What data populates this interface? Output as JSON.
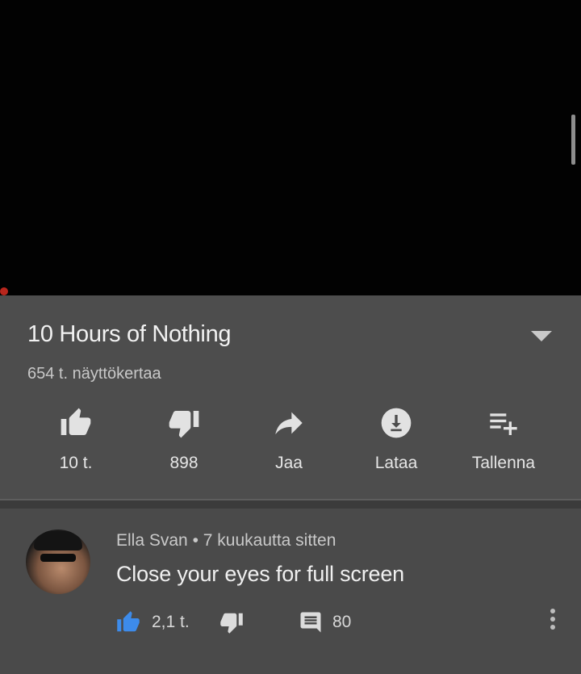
{
  "video": {
    "title": "10 Hours of Nothing",
    "views": "654 t. näyttökertaa"
  },
  "actions": [
    {
      "label": "10 t.",
      "icon": "thumbs-up-icon"
    },
    {
      "label": "898",
      "icon": "thumbs-down-icon"
    },
    {
      "label": "Jaa",
      "icon": "share-icon"
    },
    {
      "label": "Lataa",
      "icon": "download-icon"
    },
    {
      "label": "Tallenna",
      "icon": "save-playlist-icon"
    }
  ],
  "comment": {
    "author": "Ella Svan",
    "separator": "•",
    "time": "7 kuukautta sitten",
    "text": "Close your eyes for full screen",
    "likes": "2,1 t.",
    "replies": "80"
  },
  "colors": {
    "like_active": "#3d8bea",
    "player_bg": "#020202",
    "panel_bg": "#4d4d4d",
    "progress": "#b8261d"
  }
}
